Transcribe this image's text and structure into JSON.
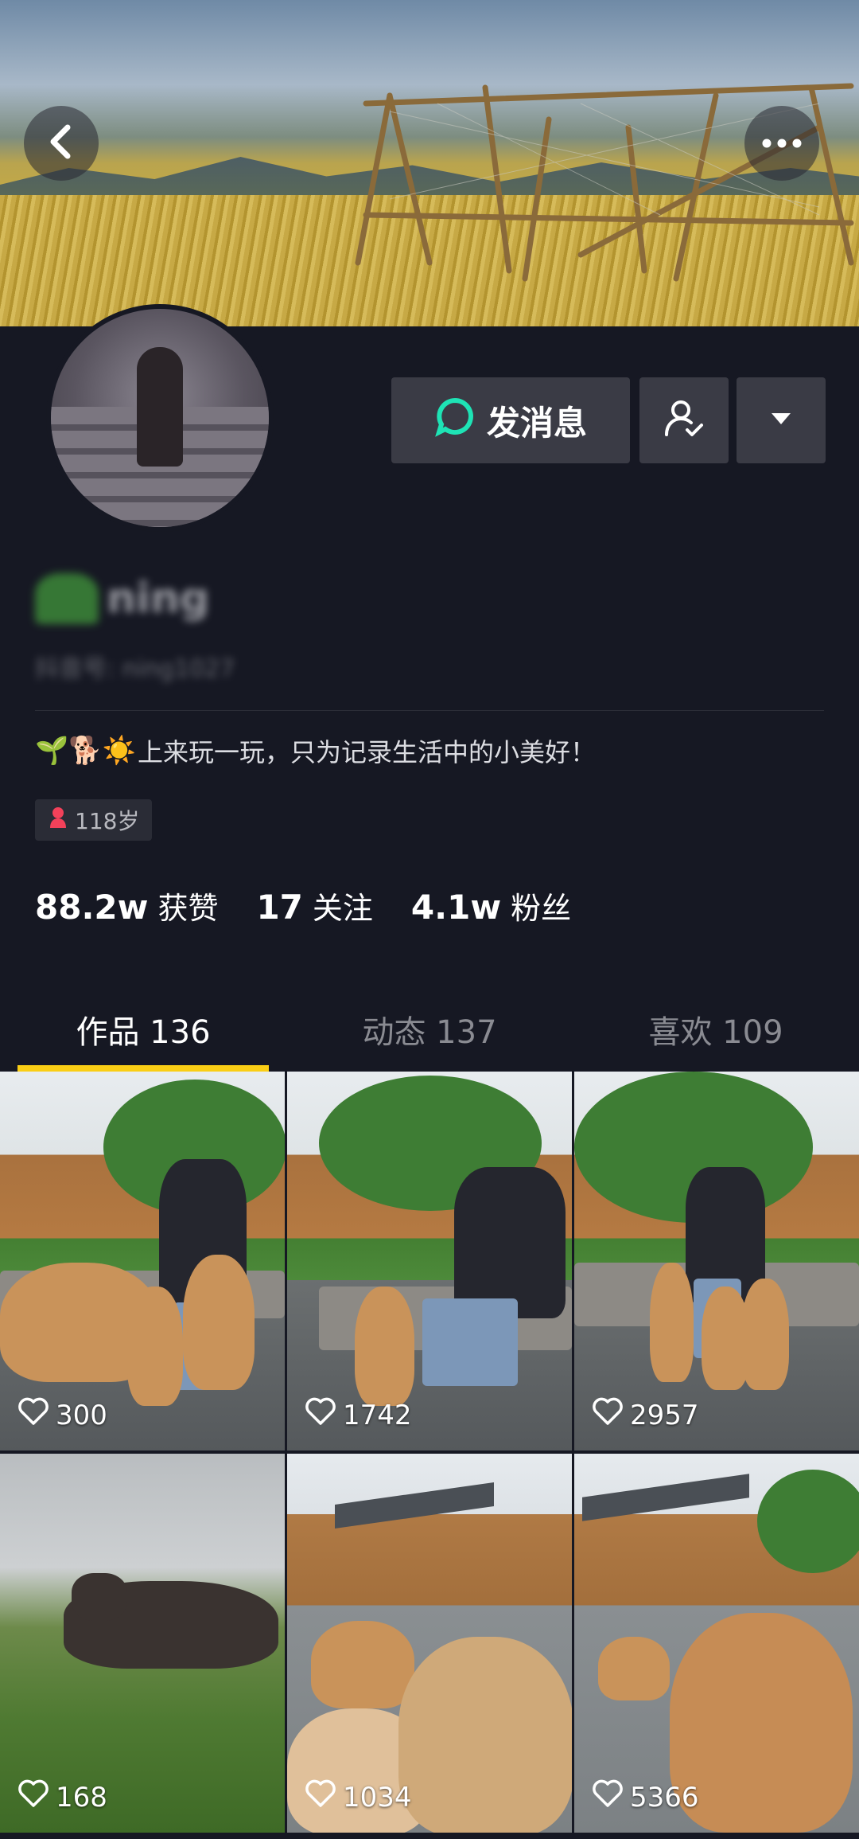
{
  "header": {
    "back_icon": "chevron-left-icon",
    "more_icon": "more-dots-icon"
  },
  "actions": {
    "message_label": "发消息",
    "message_icon": "chat-bubble-icon",
    "follow_icon": "user-check-icon",
    "dropdown_icon": "triangle-down-icon"
  },
  "profile": {
    "name_blurred": "ning",
    "id_blurred": "抖音号: ning1027",
    "bio_emojis": "🌱🐕☀️",
    "bio_text": "上来玩一玩，只为记录生活中的小美好！",
    "age_label": "118岁",
    "gender_icon": "female-icon"
  },
  "stats": [
    {
      "num": "88.2w",
      "label": "获赞"
    },
    {
      "num": "17",
      "label": "关注"
    },
    {
      "num": "4.1w",
      "label": "粉丝"
    }
  ],
  "tabs": [
    {
      "label": "作品 136",
      "active": true
    },
    {
      "label": "动态 137",
      "active": false
    },
    {
      "label": "喜欢 109",
      "active": false
    }
  ],
  "videos": [
    {
      "likes": "300"
    },
    {
      "likes": "1742"
    },
    {
      "likes": "2957"
    },
    {
      "likes": "168"
    },
    {
      "likes": "1034"
    },
    {
      "likes": "5366"
    }
  ],
  "colors": {
    "background": "#161823",
    "button_bg": "#3a3b45",
    "tab_indicator": "#face15",
    "chat_icon": "#1ee3b5",
    "gender_icon": "#f2415a"
  }
}
